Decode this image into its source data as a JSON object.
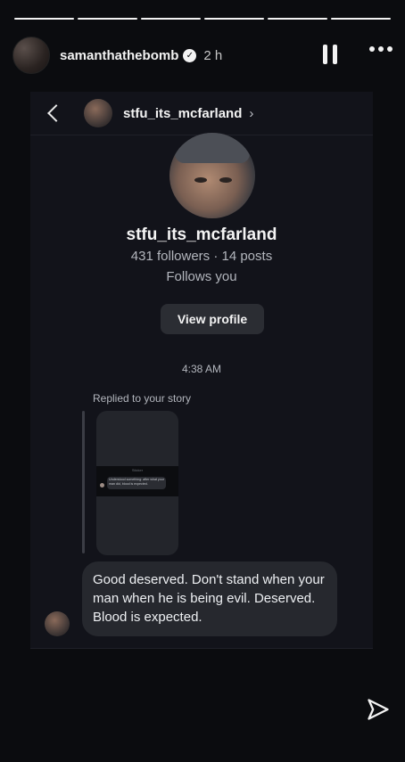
{
  "story_header": {
    "username": "samanthathebomb",
    "time": "2 h",
    "verified": true,
    "progress_segments": 6
  },
  "dm": {
    "username": "stfu_its_mcfarland",
    "profile": {
      "name": "stfu_its_mcfarland",
      "stats": "431 followers · 14 posts",
      "follows_you": "Follows you",
      "view_profile_label": "View profile"
    },
    "timestamp": "4:38 AM",
    "replied_label": "Replied to your story",
    "story_preview": {
      "mini_title": "Sticker",
      "mini_message": "Understood something: after what your man did, blood is expected."
    },
    "message": "Good deserved. Don't stand when your man when he is being evil. Deserved. Blood is expected."
  },
  "icons": {
    "back": "chevron-left-icon",
    "more": "more-icon",
    "pause": "pause-icon",
    "send": "send-icon",
    "verified": "verified-badge-icon"
  },
  "colors": {
    "background": "#0b0c0f",
    "panel": "#12131a",
    "bubble": "#26282e",
    "button": "#2b2d33",
    "text": "#f1f3f5",
    "muted": "#b3b6bd"
  }
}
